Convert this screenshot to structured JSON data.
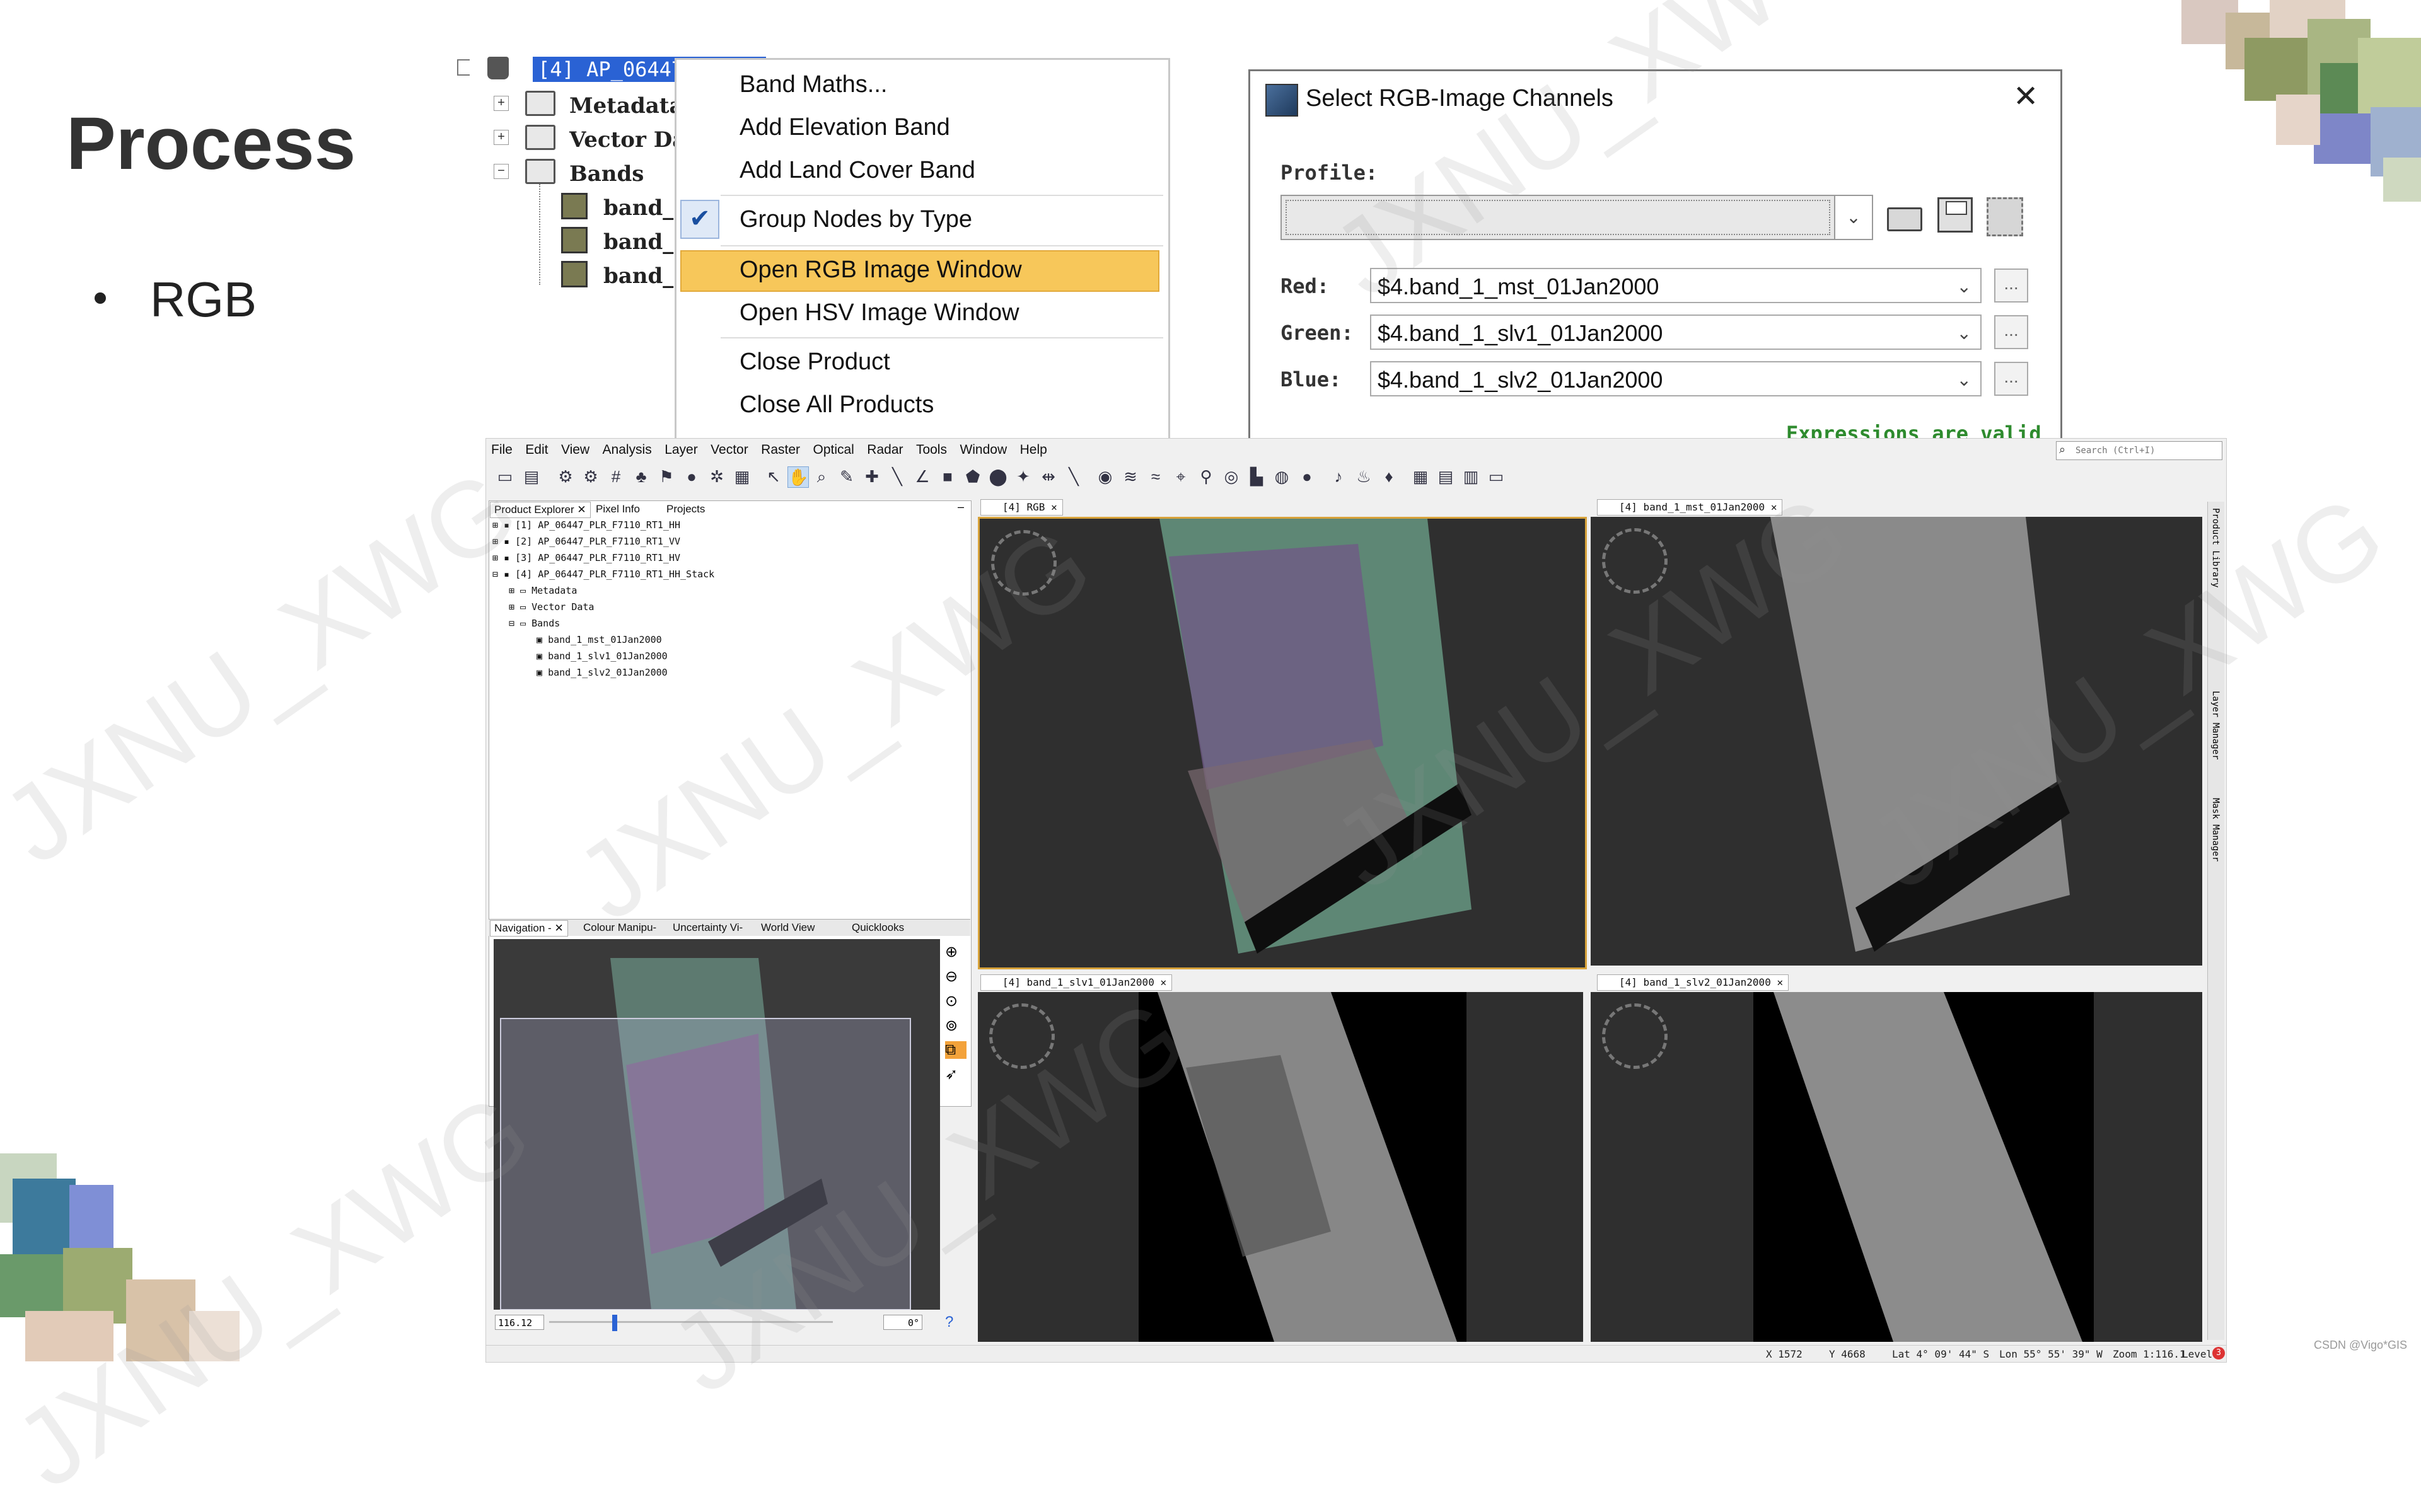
{
  "slide": {
    "title": "Process",
    "bullet": "RGB",
    "watermark": "JXNU_XWG",
    "credit": "CSDN @Vigo*GIS"
  },
  "tree": {
    "product": "[4] AP_06447",
    "nodes": [
      "Metadata",
      "Vector Da",
      "Bands"
    ],
    "bands": [
      "band_1",
      "band_1",
      "band_1"
    ]
  },
  "context_menu": {
    "items": [
      "Band Maths...",
      "Add Elevation Band",
      "Add Land Cover Band",
      "Group Nodes by Type",
      "Open RGB Image Window",
      "Open HSV Image Window",
      "Close Product",
      "Close All Products"
    ],
    "checked_item": "Group Nodes by Type",
    "highlighted_item": "Open RGB Image Window",
    "highlight_color": "#f7c75a"
  },
  "dialog": {
    "title": "Select RGB-Image Channels",
    "profile_label": "Profile:",
    "profile_value": "",
    "red_label": "Red:",
    "red_value": "$4.band_1_mst_01Jan2000",
    "green_label": "Green:",
    "green_value": "$4.band_1_slv1_01Jan2000",
    "blue_label": "Blue:",
    "blue_value": "$4.band_1_slv2_01Jan2000",
    "status": "Expressions are valid",
    "status_color": "#2e8b2e"
  },
  "snap": {
    "menus": [
      "File",
      "Edit",
      "View",
      "Analysis",
      "Layer",
      "Vector",
      "Raster",
      "Optical",
      "Radar",
      "Tools",
      "Window",
      "Help"
    ],
    "search_placeholder": "Search (Ctrl+I)",
    "top_tabs": [
      "Product Explorer",
      "Pixel Info",
      "Projects"
    ],
    "products": [
      "[1] AP_06447_PLR_F7110_RT1_HH",
      "[2] AP_06447_PLR_F7110_RT1_VV",
      "[3] AP_06447_PLR_F7110_RT1_HV",
      "[4] AP_06447_PLR_F7110_RT1_HH_Stack"
    ],
    "product4_children": [
      "Metadata",
      "Vector Data",
      "Bands"
    ],
    "bands": [
      "band_1_mst_01Jan2000",
      "band_1_slv1_01Jan2000",
      "band_1_slv2_01Jan2000"
    ],
    "bottom_tabs": [
      "Navigation -",
      "Colour Manipu-",
      "Uncertainty Vi-",
      "World View",
      "Quicklooks"
    ],
    "nav_zoom": "116.12",
    "nav_angle": "0°",
    "view_tabs": [
      "[4] RGB",
      "[4] band_1_mst_01Jan2000",
      "[4] band_1_slv1_01Jan2000",
      "[4] band_1_slv2_01Jan2000"
    ],
    "right_strip": [
      "Product Library",
      "Layer Manager",
      "Mask Manager"
    ],
    "status": {
      "x": "X 1572",
      "y": "Y 4668",
      "lat": "Lat 4° 09' 44\" S",
      "lon": "Lon 55° 55' 39\" W",
      "zoom": "Zoom 1:116.1",
      "level": "Level 3",
      "notifications": "3"
    }
  }
}
